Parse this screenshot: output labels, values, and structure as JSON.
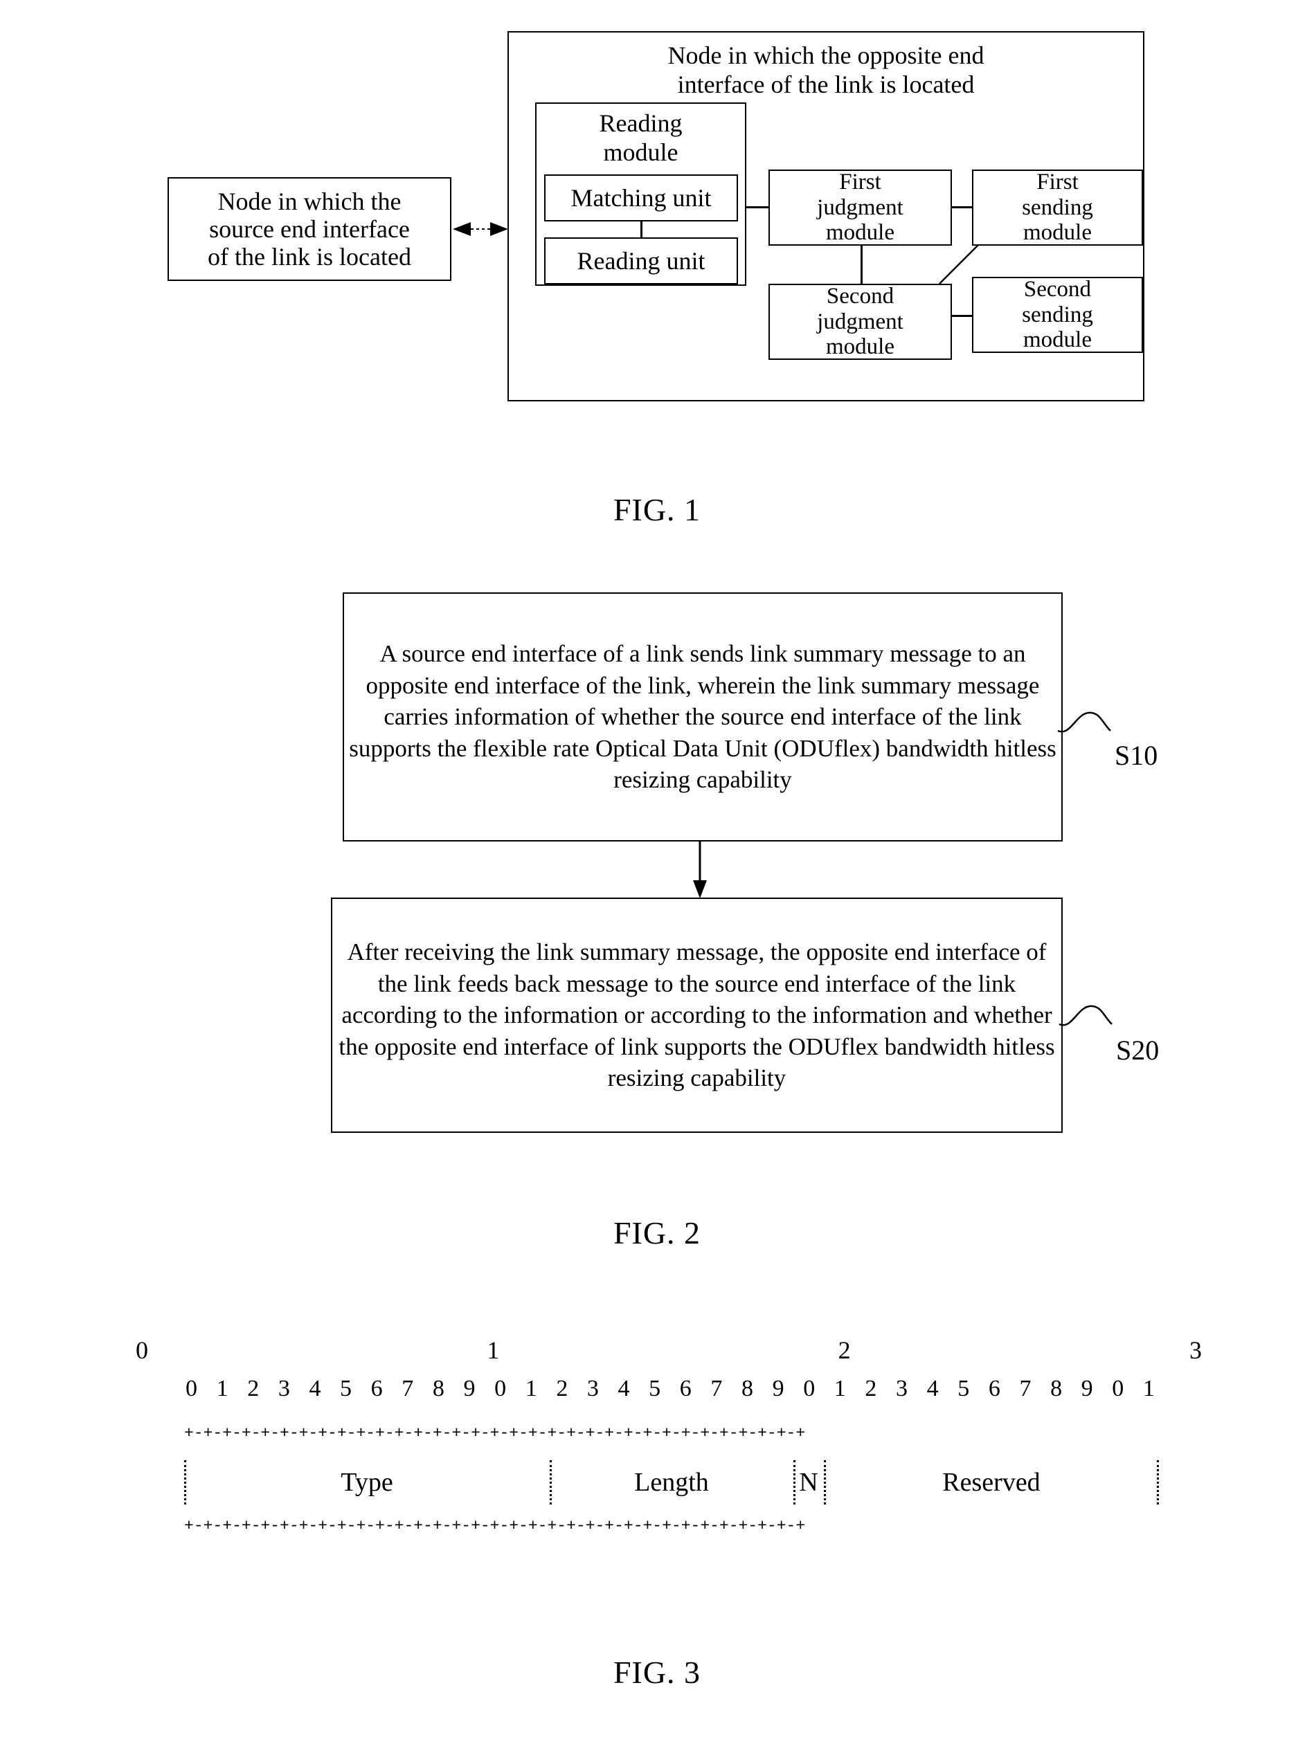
{
  "figure1": {
    "caption": "FIG. 1",
    "outer_block_title": "Node in which the opposite end\ninterface of the link is located",
    "source_node": "Node in which the\nsource end interface\nof the link is located",
    "reading_module": "Reading\nmodule",
    "matching_unit": "Matching unit",
    "reading_unit": "Reading unit",
    "first_judgment_module": "First\njudgment\nmodule",
    "first_sending_module": "First\nsending\nmodule",
    "second_judgment_module": "Second\njudgment\nmodule",
    "second_sending_module": "Second\nsending\nmodule",
    "link_arrow": "bidirectional-arrow"
  },
  "figure2": {
    "caption": "FIG. 2",
    "step1_text": "A source end interface of a link sends link summary message to an opposite end interface of the link, wherein the link summary message carries information of whether the source end interface of the link supports the flexible rate Optical Data Unit (ODUflex) bandwidth hitless resizing capability",
    "step1_label": "S10",
    "step2_text": "After receiving the link summary message, the opposite end interface of the link feeds back message to the source end interface of the link according to the information or according to the information and whether the opposite end interface of link supports the ODUflex bandwidth hitless resizing capability",
    "step2_label": "S20",
    "flow_arrow": "down-arrow"
  },
  "figure3": {
    "caption": "FIG. 3",
    "word_markers": [
      "0",
      "1",
      "2",
      "3"
    ],
    "bit_numbers": [
      "0",
      "1",
      "2",
      "3",
      "4",
      "5",
      "6",
      "7",
      "8",
      "9",
      "0",
      "1",
      "2",
      "3",
      "4",
      "5",
      "6",
      "7",
      "8",
      "9",
      "0",
      "1",
      "2",
      "3",
      "4",
      "5",
      "6",
      "7",
      "8",
      "9",
      "0",
      "1"
    ],
    "ruler": "+-+-+-+-+-+-+-+-+-+-+-+-+-+-+-+-+-+-+-+-+-+-+-+-+-+-+-+-+-+-+-+-+",
    "fields": [
      {
        "label": "Type",
        "bits": 12
      },
      {
        "label": "Length",
        "bits": 8
      },
      {
        "label": "N",
        "bits": 1
      },
      {
        "label": "Reserved",
        "bits": 11
      }
    ]
  }
}
